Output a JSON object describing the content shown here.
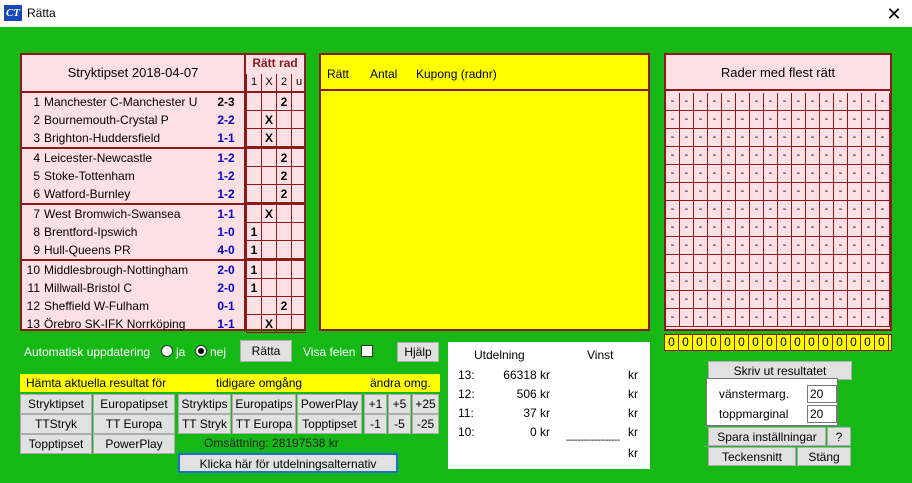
{
  "window": {
    "icon_text": "CT",
    "title": "Rätta",
    "close_glyph": "✕"
  },
  "match_panel": {
    "title": "Stryktipset 2018-04-07",
    "ratt_rad_label": "Rätt rad",
    "columns": [
      "1",
      "X",
      "2",
      "u"
    ],
    "rows": [
      {
        "num": "1",
        "name": "Manchester C-Manchester U",
        "score": "2-3",
        "mark": "2"
      },
      {
        "num": "2",
        "name": "Bournemouth-Crystal P",
        "score": "2-2",
        "mark": "X"
      },
      {
        "num": "3",
        "name": "Brighton-Huddersfield",
        "score": "1-1",
        "mark": "X"
      },
      {
        "num": "4",
        "name": "Leicester-Newcastle",
        "score": "1-2",
        "mark": "2"
      },
      {
        "num": "5",
        "name": "Stoke-Tottenham",
        "score": "1-2",
        "mark": "2"
      },
      {
        "num": "6",
        "name": "Watford-Burnley",
        "score": "1-2",
        "mark": "2"
      },
      {
        "num": "7",
        "name": "West Bromwich-Swansea",
        "score": "1-1",
        "mark": "X"
      },
      {
        "num": "8",
        "name": "Brentford-Ipswich",
        "score": "1-0",
        "mark": "1"
      },
      {
        "num": "9",
        "name": "Hull-Queens PR",
        "score": "4-0",
        "mark": "1"
      },
      {
        "num": "10",
        "name": "Middlesbrough-Nottingham",
        "score": "2-0",
        "mark": "1"
      },
      {
        "num": "11",
        "name": "Millwall-Bristol C",
        "score": "2-0",
        "mark": "1"
      },
      {
        "num": "12",
        "name": "Sheffield W-Fulham",
        "score": "0-1",
        "mark": "2"
      },
      {
        "num": "13",
        "name": "Örebro SK-IFK Norrköping",
        "score": "1-1",
        "mark": "X"
      }
    ]
  },
  "result_panel": {
    "col_ratt": "Rätt",
    "col_antal": "Antal",
    "col_kupong": "Kupong (radnr)"
  },
  "rader_panel": {
    "title": "Rader med flest rätt",
    "cell_value": "-",
    "zero_value": "0"
  },
  "controls": {
    "auto_update_label": "Automatisk uppdatering",
    "radio_yes_label": "ja",
    "radio_no_label": "nej",
    "ratta_button": "Rätta",
    "visa_felen_label": "Visa felen",
    "hjalp_button": "Hjälp"
  },
  "hamta": {
    "label_current": "Hämta aktuella resultat för",
    "label_previous": "tidigare omgång",
    "label_change": "ändra omg.",
    "current_buttons": [
      "Stryktipset",
      "Europatipset",
      "TTStryk",
      "TT Europa",
      "Topptipset",
      "PowerPlay"
    ],
    "previous_buttons": [
      "Stryktips",
      "Europatips",
      "PowerPlay",
      "TT Stryk",
      "TT Europa",
      "Topptipset"
    ],
    "change_buttons": [
      "+1",
      "+5",
      "+25",
      "-1",
      "-5",
      "-25"
    ],
    "omsattning": "Omsättning: 28197538 kr",
    "klicka_button": "Klicka här för utdelningsalternativ"
  },
  "utdelning": {
    "header_utdelning": "Utdelning",
    "header_vinst": "Vinst",
    "rows": [
      {
        "level": "13:",
        "amount": "66318 kr",
        "vinst": "kr"
      },
      {
        "level": "12:",
        "amount": "506 kr",
        "vinst": "kr"
      },
      {
        "level": "11:",
        "amount": "37 kr",
        "vinst": "kr"
      },
      {
        "level": "10:",
        "amount": "0 kr",
        "vinst": "kr"
      }
    ],
    "separator": "-------------------",
    "total_vinst": "kr"
  },
  "print_panel": {
    "skriv_button": "Skriv ut resultatet",
    "vanstermarg_label": "vänstermarg.",
    "vanstermarg_value": "20",
    "toppmarginal_label": "toppmarginal",
    "toppmarginal_value": "20",
    "spara_button": "Spara inställningar",
    "help_button": "?",
    "teckensnitt_button": "Teckensnitt",
    "stang_button": "Stäng"
  },
  "colors": {
    "background": "#16b816",
    "panel_pink": "#fde0e6",
    "panel_yellow": "#ffff00",
    "border_dark_red": "#8b1a1a",
    "score_blue": "#0000cc"
  }
}
